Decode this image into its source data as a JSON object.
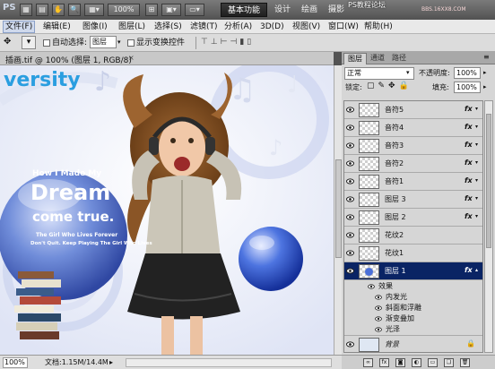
{
  "titlebar": {
    "logo": "PS",
    "zoom": "100%",
    "workspace_active": "基本功能",
    "workspaces": [
      "设计",
      "绘画",
      "摄影"
    ],
    "watermark": "PS教程论坛",
    "watermark_url": "BBS.16XX8.COM"
  },
  "menu": [
    "文件(F)",
    "编辑(E)",
    "图像(I)",
    "图层(L)",
    "选择(S)",
    "滤镜(T)",
    "分析(A)",
    "3D(D)",
    "视图(V)",
    "窗口(W)",
    "帮助(H)"
  ],
  "options": {
    "auto_select_label": "自动选择:",
    "auto_select_value": "图层",
    "show_transform_label": "显示变换控件"
  },
  "document": {
    "tab_title": "插画.tif @ 100% (图层 1, RGB/8)",
    "close": "×"
  },
  "canvas": {
    "university": "versity",
    "small_lines": [
      "How I Made My",
      "Dream",
      "come true."
    ],
    "tagline1": "The Girl Who Lives Forever",
    "tagline2": "Don't Quit. Keep Playing The Girl Who Lives"
  },
  "status": {
    "zoom": "100%",
    "doc_info": "文档:1.15M/14.4M"
  },
  "panel": {
    "tabs": [
      "图层",
      "通道",
      "路径"
    ],
    "blend_mode": "正常",
    "opacity_label": "不透明度:",
    "opacity": "100%",
    "lock_label": "锁定:",
    "fill_label": "填充:",
    "fill": "100%",
    "layers": [
      {
        "name": "音符5",
        "fx": "fx"
      },
      {
        "name": "音符4",
        "fx": "fx"
      },
      {
        "name": "音符3",
        "fx": "fx"
      },
      {
        "name": "音符2",
        "fx": "fx"
      },
      {
        "name": "音符1",
        "fx": "fx"
      },
      {
        "name": "图层 3",
        "fx": "fx"
      },
      {
        "name": "图层 2",
        "fx": "fx"
      },
      {
        "name": "花纹2",
        "fx": ""
      },
      {
        "name": "花纹1",
        "fx": ""
      },
      {
        "name": "图层 1",
        "fx": "fx",
        "selected": true
      }
    ],
    "effects_label": "效果",
    "effects": [
      "内发光",
      "斜面和浮雕",
      "渐变叠加",
      "光泽"
    ],
    "background": "背景"
  },
  "colors": {
    "selected_layer": "#0a2464",
    "accent_blue": "#2f5dc8"
  }
}
